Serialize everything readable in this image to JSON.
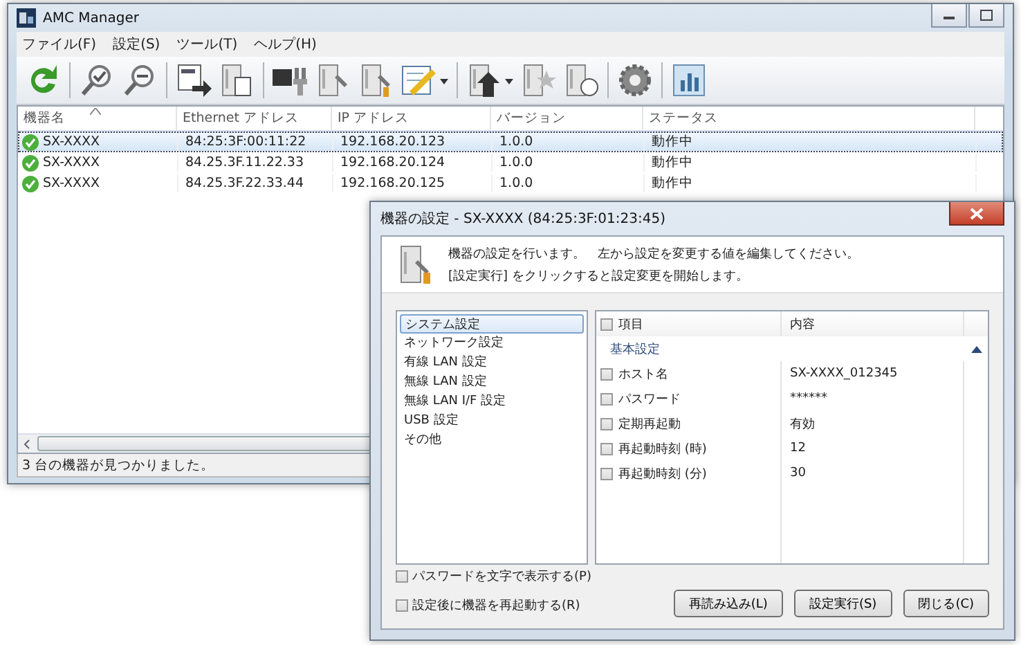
{
  "main_window": {
    "title": "AMC Manager",
    "menu": [
      "ファイル(F)",
      "設定(S)",
      "ツール(T)",
      "ヘルプ(H)"
    ],
    "columns": [
      {
        "label": "機器名",
        "sorted": true
      },
      {
        "label": "Ethernet アドレス",
        "sorted": false
      },
      {
        "label": "IP アドレス",
        "sorted": false
      },
      {
        "label": "バージョン",
        "sorted": false
      },
      {
        "label": "ステータス",
        "sorted": false
      }
    ],
    "rows": [
      {
        "selected": true,
        "cells": [
          "SX-XXXX",
          "84:25:3F:00:11:22",
          "192.168.20.123",
          "1.0.0",
          "動作中"
        ]
      },
      {
        "selected": false,
        "cells": [
          "SX-XXXX",
          "84.25.3F.11.22.33",
          "192.168.20.124",
          "1.0.0",
          "動作中"
        ]
      },
      {
        "selected": false,
        "cells": [
          "SX-XXXX",
          "84.25.3F.22.33.44",
          "192.168.20.125",
          "1.0.0",
          "動作中"
        ]
      }
    ],
    "status_bar": "3 台の機器が見つかりました。"
  },
  "dialog": {
    "title": "機器の設定 - SX-XXXX (84:25:3F:01:23:45)",
    "message": [
      "機器の設定を行います。　左から設定を変更する値を編集してください。",
      "[設定実行] をクリックすると設定変更を開始します。"
    ],
    "categories": [
      {
        "label": "システム設定",
        "selected": true
      },
      {
        "label": "ネットワーク設定",
        "selected": false
      },
      {
        "label": "有線 LAN 設定",
        "selected": false
      },
      {
        "label": "無線 LAN 設定",
        "selected": false
      },
      {
        "label": "無線 LAN I/F 設定",
        "selected": false
      },
      {
        "label": "USB 設定",
        "selected": false
      },
      {
        "label": "その他",
        "selected": false
      }
    ],
    "table": {
      "columns": [
        "項目",
        "内容"
      ],
      "header_checked": false,
      "rows": [
        {
          "kind": "group",
          "label": "基本設定",
          "expanded": true
        },
        {
          "kind": "setting",
          "label": "ホスト名",
          "value": "SX-XXXX_012345",
          "checked": false
        },
        {
          "kind": "setting",
          "label": "パスワード",
          "value": "******",
          "checked": false
        },
        {
          "kind": "setting",
          "label": "定期再起動",
          "value": "有効",
          "checked": false
        },
        {
          "kind": "setting",
          "label": "再起動時刻 (時)",
          "value": "12",
          "checked": false
        },
        {
          "kind": "setting",
          "label": "再起動時刻 (分)",
          "value": "30",
          "checked": false
        }
      ]
    },
    "options": [
      {
        "label": "パスワードを文字で表示する(P)",
        "checked": false
      },
      {
        "label": "設定後に機器を再起動する(R)",
        "checked": false
      }
    ],
    "buttons": [
      "再読み込み(L)",
      "設定実行(S)",
      "閉じる(C)"
    ]
  }
}
